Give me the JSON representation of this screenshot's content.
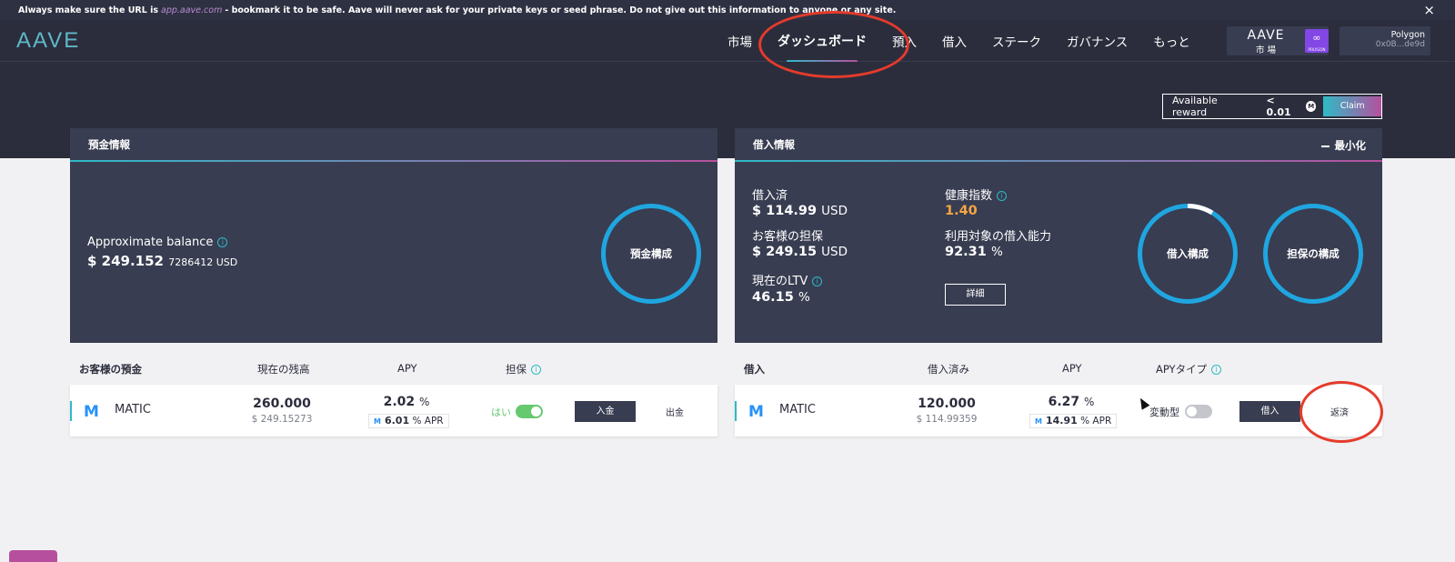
{
  "banner": {
    "prefix": "Always make sure the URL is",
    "link": "app.aave.com",
    "suffix": "- bookmark it to be safe. Aave will never ask for your private keys or seed phrase. Do not give out this information to anyone or any site.",
    "close": "×"
  },
  "header": {
    "logo": "AAVE",
    "nav": [
      "市場",
      "ダッシュボード",
      "預入",
      "借入",
      "ステーク",
      "ガバナンス",
      "もっと"
    ],
    "active_nav": "ダッシュボード",
    "market": {
      "title": "AAVE",
      "subtitle": "市 場",
      "network_badge": "POLYGON"
    },
    "account": {
      "network": "Polygon",
      "address": "0x0B...de9d"
    }
  },
  "reward": {
    "label": "Available reward",
    "value": "< 0.01",
    "claim": "Claim"
  },
  "deposit_panel": {
    "title": "預金情報",
    "balance_label": "Approximate balance",
    "balance_main": "$ 249.152",
    "balance_rest": "7286412 USD",
    "ring_label": "預金構成"
  },
  "borrow_panel": {
    "title": "借入情報",
    "minimize": "最小化",
    "borrowed_label": "借入済",
    "borrowed_value": "$ 114.99",
    "borrowed_unit": "USD",
    "collateral_label": "お客様の担保",
    "collateral_value": "$ 249.15",
    "collateral_unit": "USD",
    "ltv_label": "現在のLTV",
    "ltv_value": "46.15",
    "ltv_unit": "%",
    "health_label": "健康指数",
    "health_value": "1.40",
    "power_label": "利用対象の借入能力",
    "power_value": "92.31",
    "power_unit": "%",
    "detail_button": "詳細",
    "ring1": "借入構成",
    "ring2": "担保の構成"
  },
  "deposits_table": {
    "headers": [
      "お客様の預金",
      "現在の残高",
      "APY",
      "担保"
    ],
    "row": {
      "asset": "MATIC",
      "balance": "260.000",
      "balance_usd": "$ 249.15273",
      "apy": "2.02",
      "apy_unit": "%",
      "apr": "6.01",
      "apr_unit": "% APR",
      "collateral_label": "はい",
      "deposit_button": "入金",
      "withdraw_button": "出金"
    }
  },
  "borrows_table": {
    "headers": [
      "借入",
      "借入済み",
      "APY",
      "APYタイプ"
    ],
    "row": {
      "asset": "MATIC",
      "borrowed": "120.000",
      "borrowed_usd": "$ 114.99359",
      "apy": "6.27",
      "apy_unit": "%",
      "apr": "14.91",
      "apr_unit": "% APR",
      "apy_type": "変動型",
      "borrow_button": "借入",
      "repay_button": "返済"
    }
  },
  "colors": {
    "accent_cyan": "#2ebac6",
    "accent_pink": "#b6509e",
    "annotation_red": "#e53b2c",
    "health_orange": "#f6a543"
  }
}
